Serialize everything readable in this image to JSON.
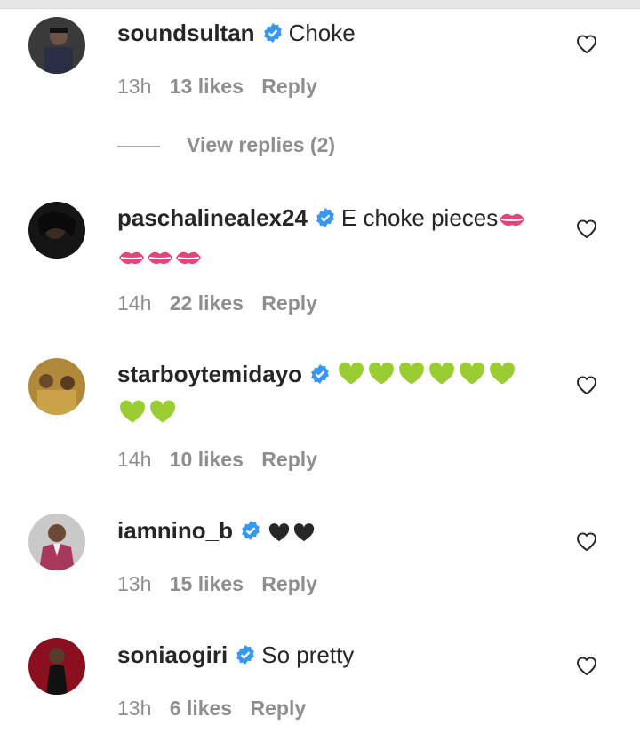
{
  "comments": [
    {
      "username": "soundsultan",
      "text": "Choke",
      "time": "13h",
      "likes": "13 likes",
      "reply": "Reply",
      "emoji_line2": ""
    },
    {
      "username": "paschalinealex24",
      "text": "E choke pieces",
      "time": "14h",
      "likes": "22 likes",
      "reply": "Reply",
      "emoji": "kiss-mark-icon"
    },
    {
      "username": "starboytemidayo",
      "text": "",
      "time": "14h",
      "likes": "10 likes",
      "reply": "Reply",
      "emoji": "green-heart-icon"
    },
    {
      "username": "iamnino_b",
      "text": "",
      "time": "13h",
      "likes": "15 likes",
      "reply": "Reply",
      "emoji": "black-heart-icon"
    },
    {
      "username": "soniaogiri",
      "text": "So pretty",
      "time": "13h",
      "likes": "6 likes",
      "reply": "Reply"
    }
  ],
  "view_replies": "View replies (2)",
  "colors": {
    "verified": "#3897f0",
    "meta": "#8e8e8e",
    "green_heart": "#9acd32",
    "kiss": "#e0457b"
  }
}
